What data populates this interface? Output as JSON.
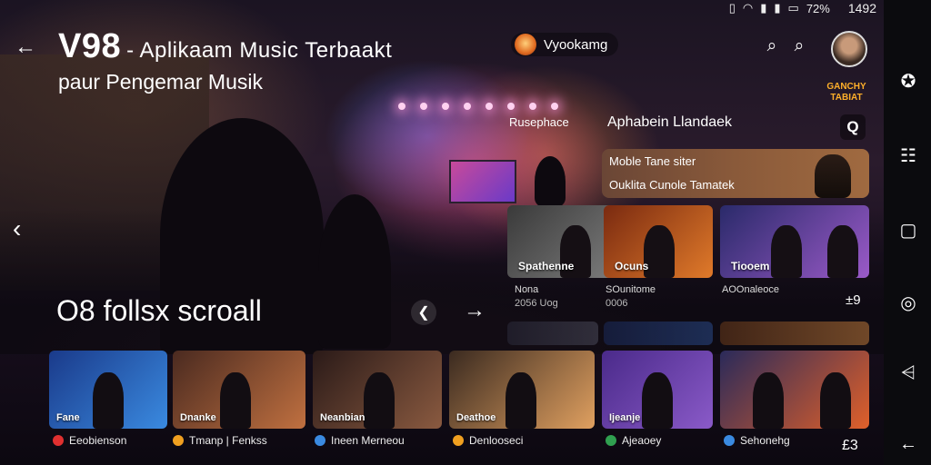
{
  "status": {
    "icons": [
      "vibrate-icon",
      "wifi-icon",
      "signal-icon",
      "signal-icon",
      "battery-icon"
    ],
    "battery": "72%",
    "time": "1492"
  },
  "header": {
    "title": "V98",
    "title_suffix": "- Aplikaam Music Terbaakt",
    "subtitle": "paur Pengemar Musik",
    "user_chip": "Vyookamg"
  },
  "side_poster": "GANCHY TABIAT",
  "panel": {
    "label": "Rusephace",
    "title": "Aphabein Llandaek",
    "featured": {
      "line1": "Moble Tane siter",
      "line2": "Ouklita Cunole Tamatek"
    },
    "cards": [
      {
        "caption": "Spathenne",
        "meta1": "Nona",
        "meta2": "2056 Uog",
        "colors": [
          "#3a3a3a",
          "#8a8a8a"
        ]
      },
      {
        "caption": "Ocuns",
        "meta1": "SOunitome",
        "meta2": "0006",
        "colors": [
          "#7a2a10",
          "#e07a2a"
        ]
      },
      {
        "caption": "Tiooem",
        "meta1": "AOOnaleoce",
        "meta2": "",
        "colors": [
          "#2a2a6a",
          "#9a5ac8"
        ]
      }
    ],
    "more_label": "±9"
  },
  "scroll_caption": "O8 follsx scroall",
  "bottom_row": [
    {
      "caption": "Fane",
      "label": "Eeobienson",
      "icon_color": "#e03030",
      "colors": [
        "#1a3a8a",
        "#3a8ae0"
      ]
    },
    {
      "caption": "Dnanke",
      "label": "Tmanp | Fenkss",
      "icon_color": "#f0a020",
      "colors": [
        "#4a2a20",
        "#c07040"
      ]
    },
    {
      "caption": "Neanbian",
      "label": "Ineen Merneou",
      "icon_color": "#3a8ae0",
      "colors": [
        "#2a1a18",
        "#8a5a40"
      ]
    },
    {
      "caption": "Deathoe",
      "label": "Denlooseci",
      "icon_color": "#f0a020",
      "colors": [
        "#3a2a20",
        "#e0a060"
      ]
    },
    {
      "caption": "Ijeanje",
      "label": "Ajeaoey",
      "icon_color": "#30a050",
      "colors": [
        "#4a2a8a",
        "#8a5ac8"
      ]
    },
    {
      "caption": "",
      "label": "Sehonehg",
      "icon_color": "#3a8ae0",
      "colors": [
        "#2a2a5a",
        "#e0602a"
      ]
    }
  ],
  "bottom_more": "£3",
  "rail": [
    "assistant-icon",
    "apps-grid-icon",
    "square-icon",
    "circle-icon",
    "share-icon",
    "back-icon"
  ]
}
